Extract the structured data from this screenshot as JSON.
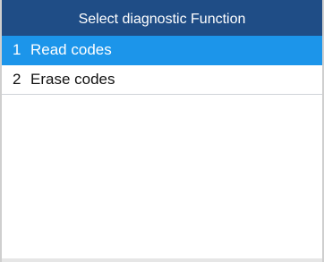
{
  "header": {
    "title": "Select diagnostic Function"
  },
  "menu": {
    "items": [
      {
        "number": "1",
        "label": "Read codes",
        "selected": true
      },
      {
        "number": "2",
        "label": "Erase codes",
        "selected": false
      }
    ]
  },
  "colors": {
    "title_bar_bg": "#1f4d86",
    "selected_bg": "#1c95ea",
    "text": "#111111"
  }
}
